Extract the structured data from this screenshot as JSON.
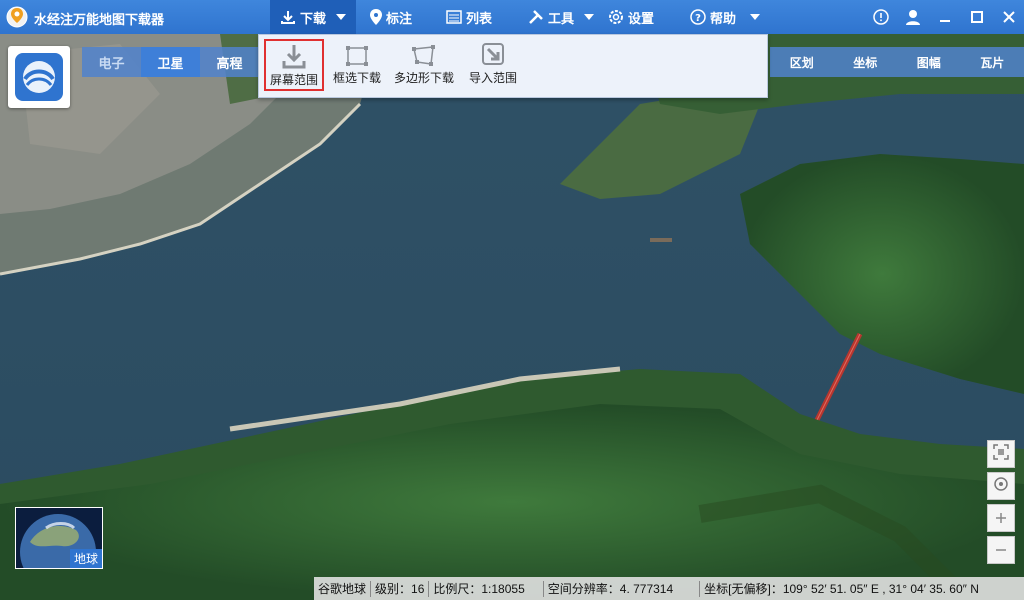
{
  "app": {
    "title": "水经注万能地图下载器"
  },
  "menu": {
    "download": "下载",
    "mark": "标注",
    "list": "列表",
    "tools": "工具",
    "settings": "设置",
    "help": "帮助"
  },
  "map_types": [
    "电子",
    "卫星",
    "高程"
  ],
  "right_tools": [
    "区划",
    "坐标",
    "图幅",
    "瓦片"
  ],
  "download_menu": {
    "items": [
      "屏幕范围",
      "框选下载",
      "多边形下载",
      "导入范围"
    ],
    "highlighted": "屏幕范围"
  },
  "globe": {
    "label": "地球"
  },
  "status": {
    "source": "谷歌地球",
    "level": "级别：16",
    "scale": "比例尺：1:18055",
    "resolution": "空间分辨率：4. 777314",
    "coordinates": "坐标[无偏移]：109° 52′ 51. 05″ E , 31° 04′ 35. 60″ N"
  },
  "icons": {
    "logo": "location-pin-logo",
    "info": "info-icon",
    "user": "user-icon",
    "minimize": "minimize-icon",
    "maximize": "maximize-icon",
    "close": "close-icon"
  },
  "colors": {
    "titlebar": "#2f74cf",
    "highlight": "#e03030",
    "river": "#2e4f66"
  }
}
